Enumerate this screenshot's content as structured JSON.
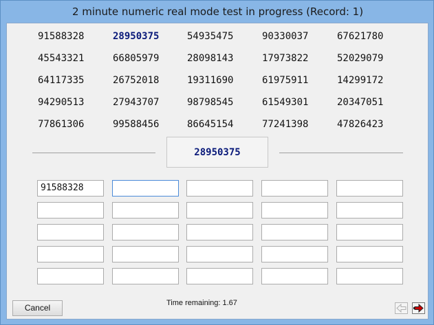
{
  "window": {
    "title": "2 minute numeric real mode test in progress (Record: 1)"
  },
  "numbers": [
    [
      "91588328",
      "28950375",
      "54935475",
      "90330037",
      "67621780"
    ],
    [
      "45543321",
      "66805979",
      "28098143",
      "17973822",
      "52029079"
    ],
    [
      "64117335",
      "26752018",
      "19311690",
      "61975911",
      "14299172"
    ],
    [
      "94290513",
      "27943707",
      "98798545",
      "61549301",
      "20347051"
    ],
    [
      "77861306",
      "99588456",
      "86645154",
      "77241398",
      "47826423"
    ]
  ],
  "current_target": "28950375",
  "answers": [
    [
      "91588328",
      "",
      "",
      "",
      ""
    ],
    [
      "",
      "",
      "",
      "",
      ""
    ],
    [
      "",
      "",
      "",
      "",
      ""
    ],
    [
      "",
      "",
      "",
      "",
      ""
    ],
    [
      "",
      "",
      "",
      "",
      ""
    ]
  ],
  "footer": {
    "cancel_label": "Cancel",
    "time_remaining": "Time remaining: 1.67"
  },
  "colors": {
    "highlight": "#0a1a7a",
    "next_arrow": "#cc0000",
    "prev_arrow": "#b0b0b0"
  },
  "icons": {
    "prev": "arrow-left-icon",
    "next": "arrow-right-icon"
  }
}
